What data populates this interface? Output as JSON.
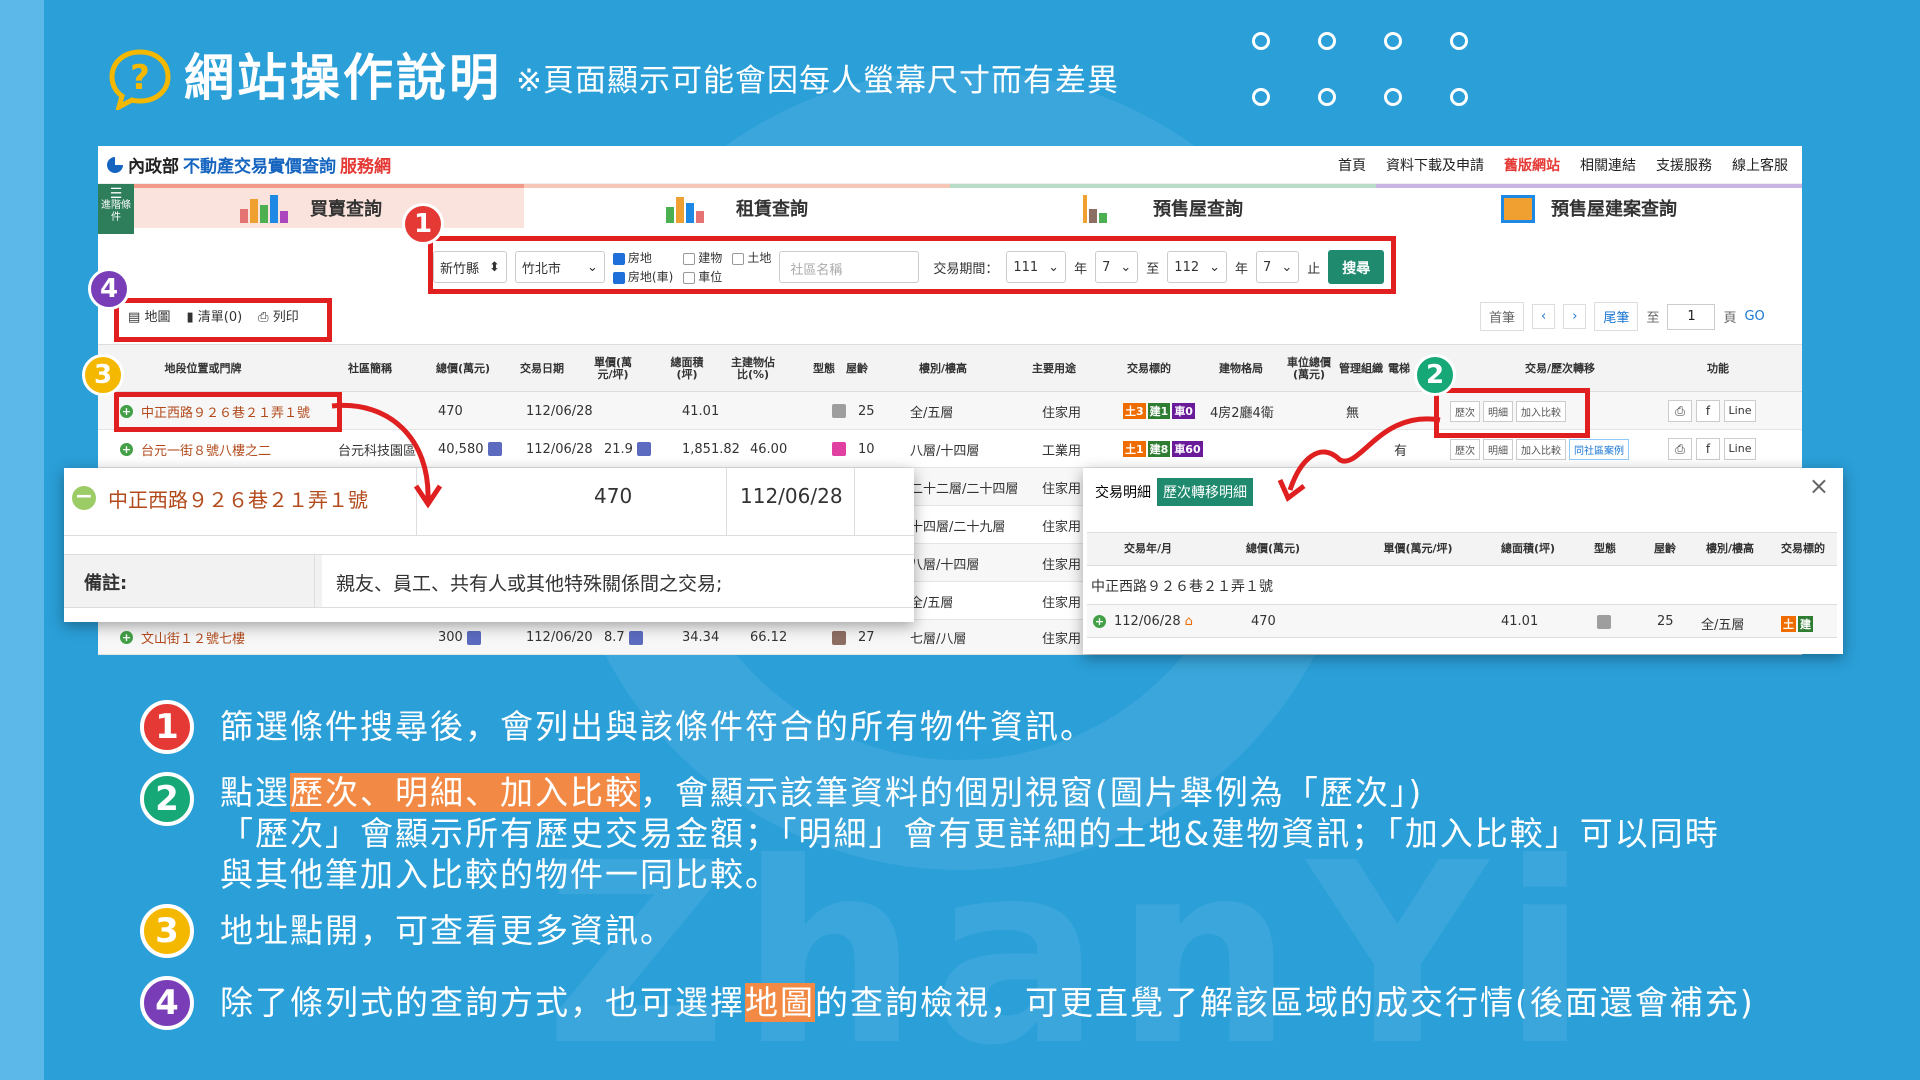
{
  "header": {
    "title": "網站操作說明",
    "subtitle": "※頁面顯示可能會因每人螢幕尺寸而有差異",
    "watermark": "ZhanYi"
  },
  "site": {
    "logo_ministry": "內政部",
    "logo_main": "不動產交易實價查詢",
    "logo_suffix": "服務網",
    "nav": [
      "首頁",
      "資料下載及申請",
      "舊版網站",
      "相關連結",
      "支援服務",
      "線上客服"
    ],
    "adv_label": "進階條件",
    "tabs": [
      "買賣查詢",
      "租賃查詢",
      "預售屋查詢",
      "預售屋建案查詢"
    ]
  },
  "filter": {
    "county": "新竹縣",
    "city": "竹北市",
    "checks": [
      {
        "label": "房地",
        "checked": true
      },
      {
        "label": "建物",
        "checked": false
      },
      {
        "label": "土地",
        "checked": false
      },
      {
        "label": "房地(車)",
        "checked": true
      },
      {
        "label": "車位",
        "checked": false
      }
    ],
    "community_placeholder": "社區名稱",
    "period_label": "交易期間：",
    "from_year": "111",
    "from_month": "7",
    "to_year": "112",
    "to_month": "7",
    "year_unit": "年",
    "to_word": "至",
    "end_word": "止",
    "search_button": "搜尋"
  },
  "tools": {
    "map": "地圖",
    "list": "清單(0)",
    "print": "列印"
  },
  "pager": {
    "first": "首筆",
    "prev": "‹",
    "next": "›",
    "last": "尾筆",
    "to": "至",
    "page": "1",
    "page_unit": "頁",
    "go": "GO"
  },
  "table": {
    "headers": [
      "地段位置或門牌",
      "社區簡稱",
      "總價(萬元)",
      "交易日期",
      "單價(萬元/坪)",
      "總面積(坪)",
      "主建物佔比(%)",
      "型態",
      "屋齡",
      "樓別/樓高",
      "主要用途",
      "交易標的",
      "建物格局",
      "車位總價(萬元)",
      "管理組織",
      "電梯",
      "交易/歷次轉移",
      "功能"
    ],
    "rows": [
      {
        "addr": "中正西路９２６巷２１弄１號",
        "community": "",
        "total": "470",
        "date": "112/06/28",
        "unit": "",
        "area": "41.01",
        "ratio": "",
        "age": "25",
        "floor": "全/五層",
        "use": "住家用",
        "target": [
          "土3",
          "建1",
          "車0"
        ],
        "layout": "4房2廳4衛",
        "parking": "",
        "mgmt": "無",
        "elevator": ""
      },
      {
        "addr": "台元一街８號八樓之二",
        "community": "台元科技園區",
        "total": "40,580",
        "date": "112/06/28",
        "unit": "21.9",
        "area": "1,851.82",
        "ratio": "46.00",
        "age": "10",
        "floor": "八層/十四層",
        "use": "工業用",
        "target": [
          "土1",
          "建8",
          "車60"
        ],
        "layout": "",
        "parking": "",
        "mgmt": "",
        "elevator": "有"
      },
      {
        "addr": "",
        "community": "",
        "total": "",
        "date": "",
        "unit": "",
        "area": "",
        "ratio": "",
        "age": "",
        "floor": "二十二層/二十四層",
        "use": "住家用",
        "target": [],
        "layout": "",
        "parking": "",
        "mgmt": "",
        "elevator": ""
      },
      {
        "addr": "",
        "community": "",
        "total": "",
        "date": "",
        "unit": "",
        "area": "",
        "ratio": "",
        "age": "",
        "floor": "十四層/二十九層",
        "use": "住家用",
        "target": [],
        "layout": "",
        "parking": "",
        "mgmt": "",
        "elevator": ""
      },
      {
        "addr": "",
        "community": "",
        "total": "",
        "date": "",
        "unit": "",
        "area": "",
        "ratio": "",
        "age": "",
        "floor": "八層/十四層",
        "use": "住家用",
        "target": [],
        "layout": "",
        "parking": "",
        "mgmt": "",
        "elevator": ""
      },
      {
        "addr": "",
        "community": "",
        "total": "",
        "date": "",
        "unit": "",
        "area": "",
        "ratio": "",
        "age": "",
        "floor": "全/五層",
        "use": "住家用",
        "target": [],
        "layout": "",
        "parking": "",
        "mgmt": "",
        "elevator": ""
      },
      {
        "addr": "文山街１２號七樓",
        "community": "",
        "total": "300",
        "date": "112/06/20",
        "unit": "8.7",
        "area": "34.34",
        "ratio": "66.12",
        "age": "27",
        "floor": "七層/八層",
        "use": "住家用",
        "target": [],
        "layout": "",
        "parking": "",
        "mgmt": "",
        "elevator": ""
      }
    ],
    "row_buttons": [
      "歷次",
      "明細",
      "加入比較",
      "同社區案例"
    ],
    "func_buttons": [
      "⎙",
      "f",
      "Line"
    ]
  },
  "popup_detail": {
    "addr": "中正西路９２６巷２１弄１號",
    "total": "470",
    "date": "112/06/28",
    "note_label": "備註:",
    "note_value": "親友、員工、共有人或其他特殊關係間之交易;"
  },
  "popup_history": {
    "tab1": "交易明細",
    "tab2": "歷次轉移明細",
    "close": "×",
    "headers": [
      "交易年/月",
      "總價(萬元)",
      "單價(萬元/坪)",
      "總面積(坪)",
      "型態",
      "屋齡",
      "樓別/樓高",
      "交易標的"
    ],
    "addr": "中正西路９２６巷２１弄１號",
    "date": "112/06/28",
    "total": "470",
    "area": "41.01",
    "age": "25",
    "floor": "全/五層"
  },
  "badges": [
    "1",
    "2",
    "3",
    "4"
  ],
  "bullets": [
    {
      "num": "1",
      "text": "篩選條件搜尋後，會列出與該條件符合的所有物件資訊。"
    },
    {
      "num": "2",
      "pre": "點選",
      "hl": "歷次、明細、加入比較",
      "post": "，會顯示該筆資料的個別視窗(圖片舉例為「歷次」)",
      "line2": "「歷次」會顯示所有歷史交易金額；「明細」會有更詳細的土地&建物資訊；「加入比較」可以同時",
      "line3": "與其他筆加入比較的物件一同比較。"
    },
    {
      "num": "3",
      "text": "地址點開，可查看更多資訊。"
    },
    {
      "num": "4",
      "pre": "除了條列式的查詢方式，也可選擇",
      "hl": "地圖",
      "post": "的查詢檢視，可更直覺了解該區域的成交行情(後面還會補充)"
    }
  ],
  "colors": {
    "background": "#2a9fd8",
    "accent_red": "#e02020",
    "badge1": "#e53935",
    "badge2": "#16a877",
    "badge3": "#f5b800",
    "badge4": "#7a3db8",
    "highlight": "#f28a45"
  }
}
